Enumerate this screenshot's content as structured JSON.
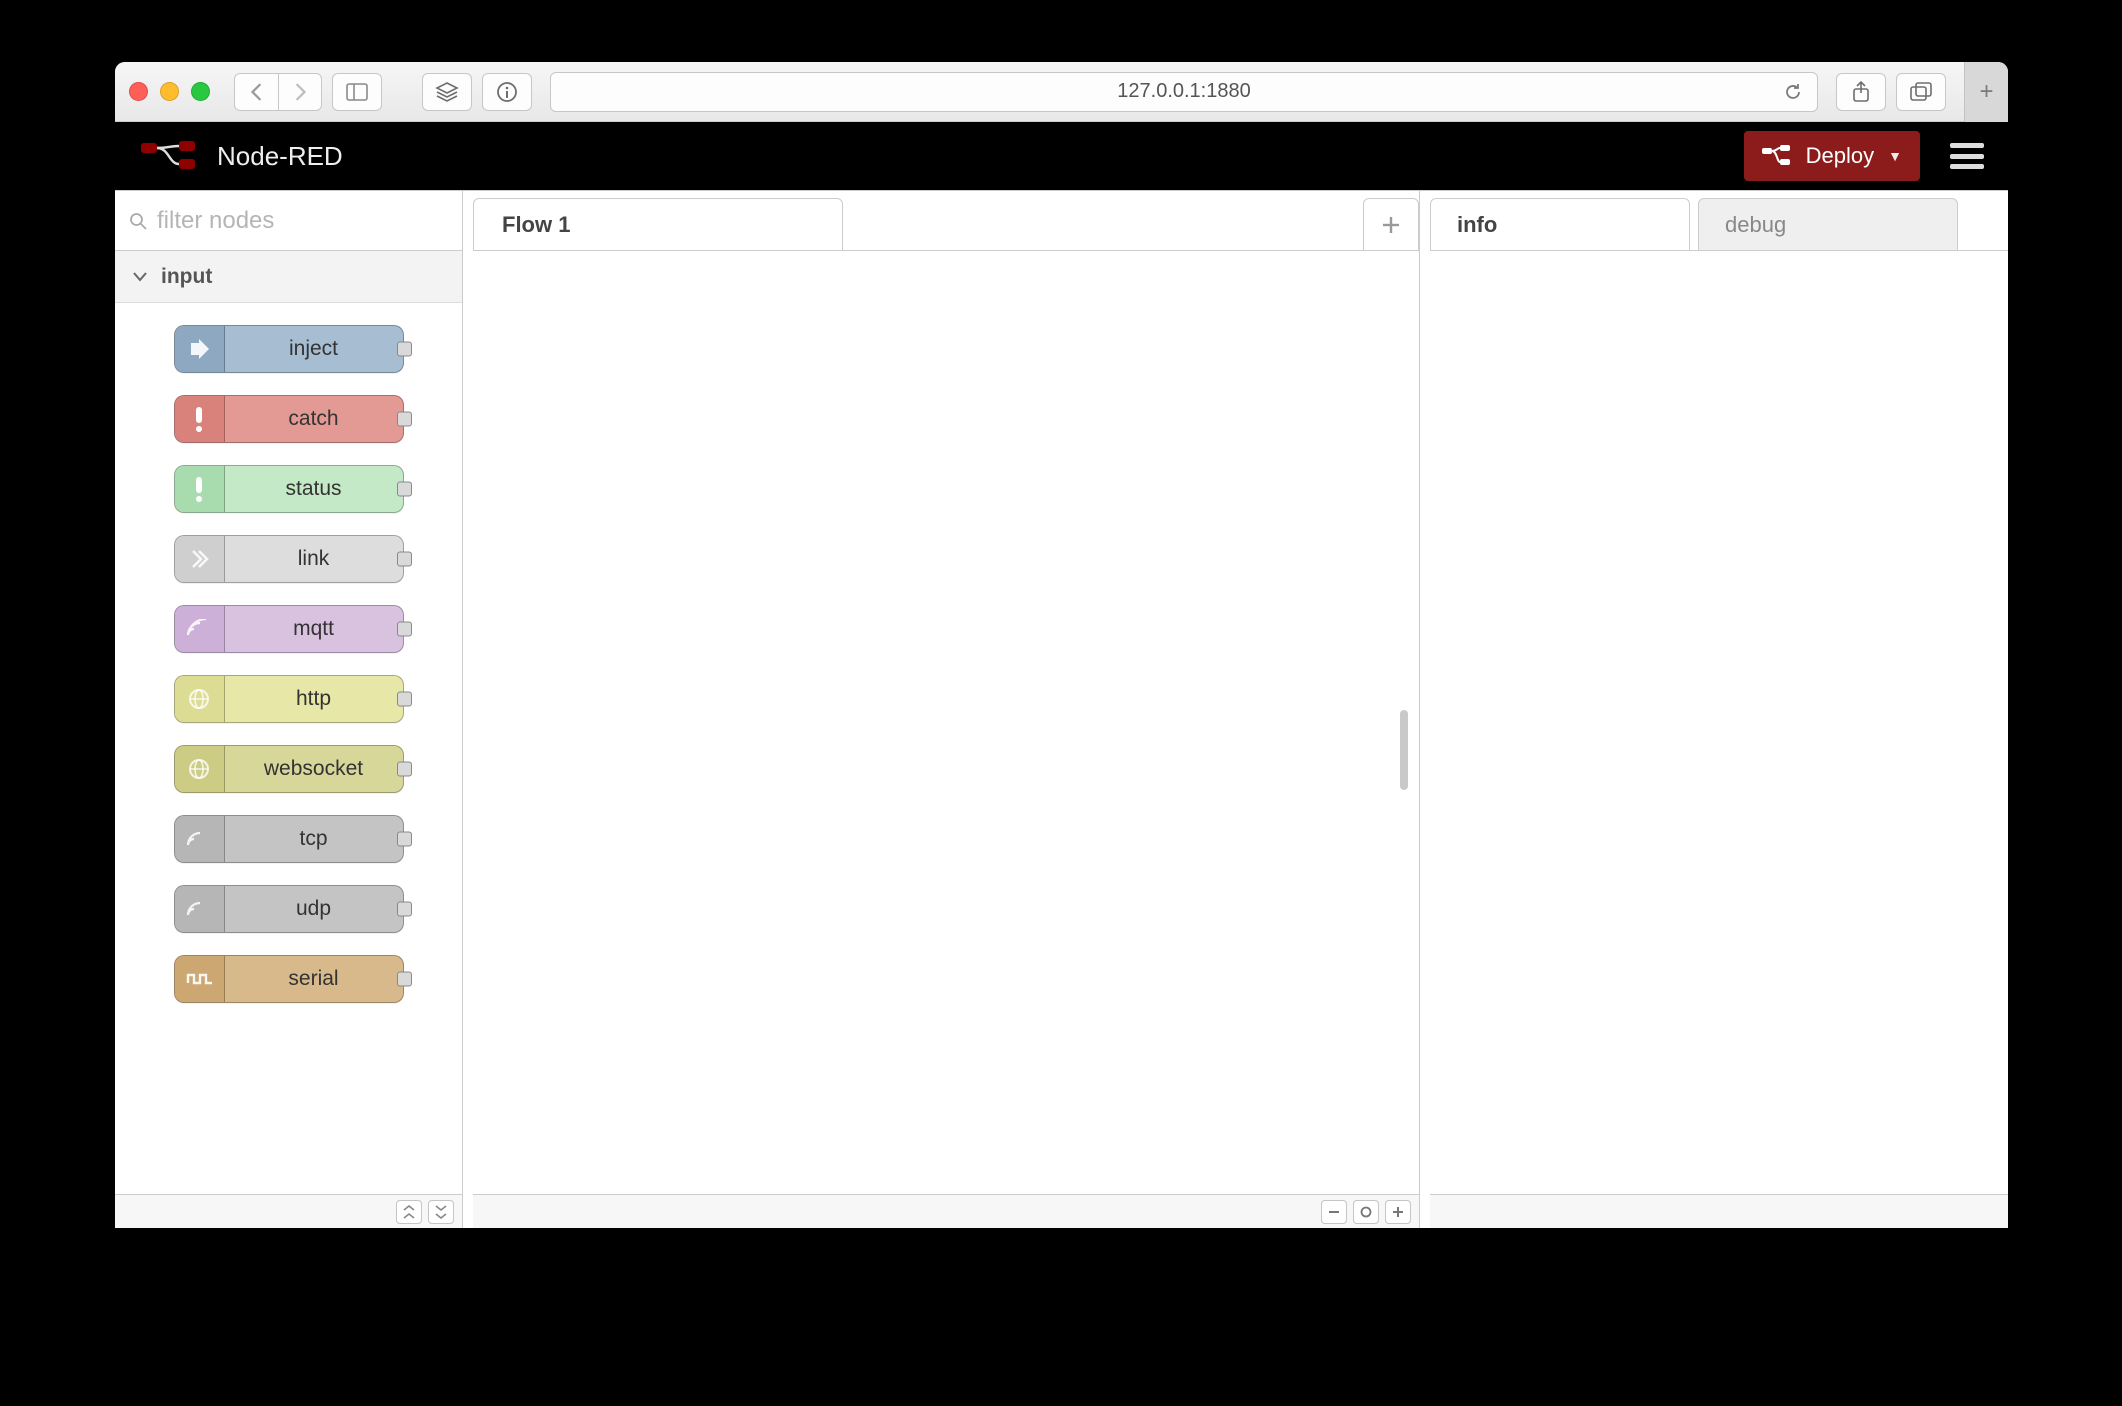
{
  "browser": {
    "address": "127.0.0.1:1880"
  },
  "header": {
    "app_title": "Node-RED",
    "deploy_label": "Deploy"
  },
  "palette": {
    "filter_placeholder": "filter nodes",
    "category": "input",
    "nodes": [
      {
        "label": "inject"
      },
      {
        "label": "catch"
      },
      {
        "label": "status"
      },
      {
        "label": "link"
      },
      {
        "label": "mqtt"
      },
      {
        "label": "http"
      },
      {
        "label": "websocket"
      },
      {
        "label": "tcp"
      },
      {
        "label": "udp"
      },
      {
        "label": "serial"
      }
    ]
  },
  "workspace": {
    "tabs": [
      {
        "label": "Flow 1"
      }
    ]
  },
  "sidebar": {
    "tabs": [
      {
        "label": "info"
      },
      {
        "label": "debug"
      }
    ]
  }
}
